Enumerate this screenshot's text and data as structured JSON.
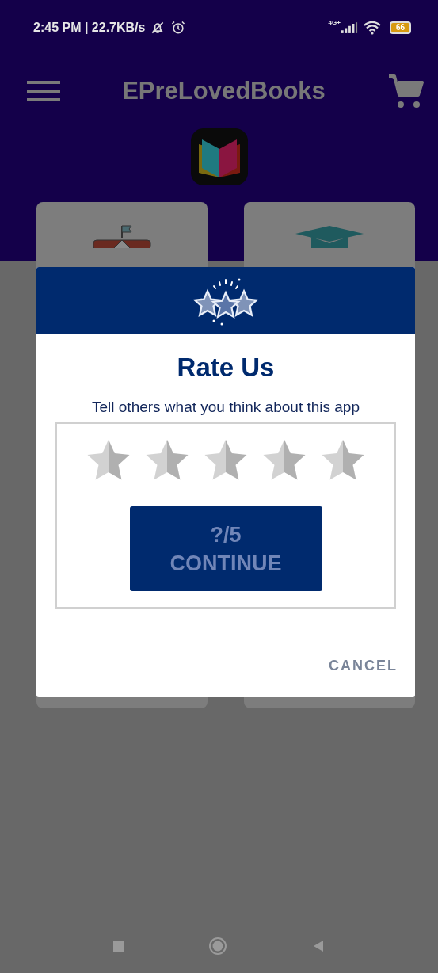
{
  "status_bar": {
    "time_speed": "2:45 PM | 22.7KB/s",
    "network": "4G+",
    "battery": "66"
  },
  "app_bar": {
    "title": "EPreLovedBooks"
  },
  "dialog": {
    "title": "Rate Us",
    "message": "Tell others what you think about this app",
    "rating": {
      "stars": 0
    },
    "continue_button": {
      "score": "?/5",
      "label": "CONTINUE",
      "disabled": true
    },
    "cancel_button": {
      "label": "CANCEL"
    }
  }
}
